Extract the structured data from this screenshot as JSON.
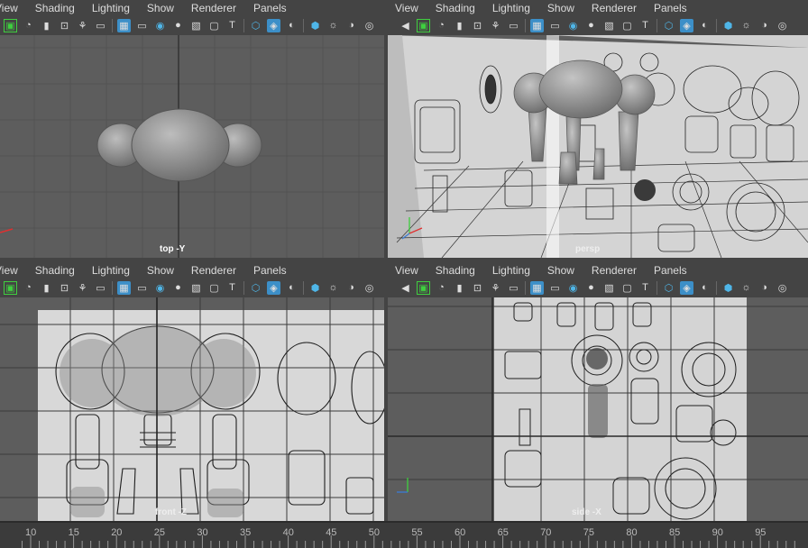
{
  "menus": {
    "top_left": [
      "View",
      "Shading",
      "Lighting",
      "Show",
      "Renderer",
      "Panels"
    ],
    "top_right": [
      "View",
      "Shading",
      "Lighting",
      "Show",
      "Renderer",
      "Panels"
    ],
    "bottom_left": [
      "View",
      "Shading",
      "Lighting",
      "Show",
      "Renderer",
      "Panels"
    ],
    "bottom_right": [
      "View",
      "Shading",
      "Lighting",
      "Show",
      "Renderer",
      "Panels"
    ]
  },
  "viewports": {
    "top": {
      "label": "top -Y"
    },
    "persp": {
      "label": "persp"
    },
    "front": {
      "label": "front -Z"
    },
    "side": {
      "label": "side -X"
    }
  },
  "axis": {
    "y": "y",
    "x": "x",
    "z": "z"
  },
  "icons": [
    "camera-icon",
    "frame-select-icon",
    "camera-attrs-icon",
    "bookmark-icon",
    "snapshot-icon",
    "image-plane-icon",
    "grid-icon",
    "film-gate-icon",
    "resolution-gate-icon",
    "gate-mask-icon",
    "field-chart-icon",
    "safe-action-icon",
    "safe-title-icon",
    "wireframe-icon",
    "smooth-shade-icon",
    "shade-options-icon",
    "xray-icon",
    "lights-icon",
    "shadows-icon",
    "ambient-occlusion-icon",
    "textures-icon"
  ],
  "colors": {
    "panel_bg": "#444444",
    "viewport_bg": "#5d5d5d",
    "image_plane": "#cfcfcf",
    "highlight": "#3c8fc8",
    "green": "#3fcf3f"
  },
  "timeline": {
    "ticks": [
      "10",
      "15",
      "20",
      "25",
      "30",
      "35",
      "40",
      "45",
      "50",
      "55",
      "60",
      "65",
      "70",
      "75",
      "80",
      "85",
      "90",
      "95"
    ]
  }
}
